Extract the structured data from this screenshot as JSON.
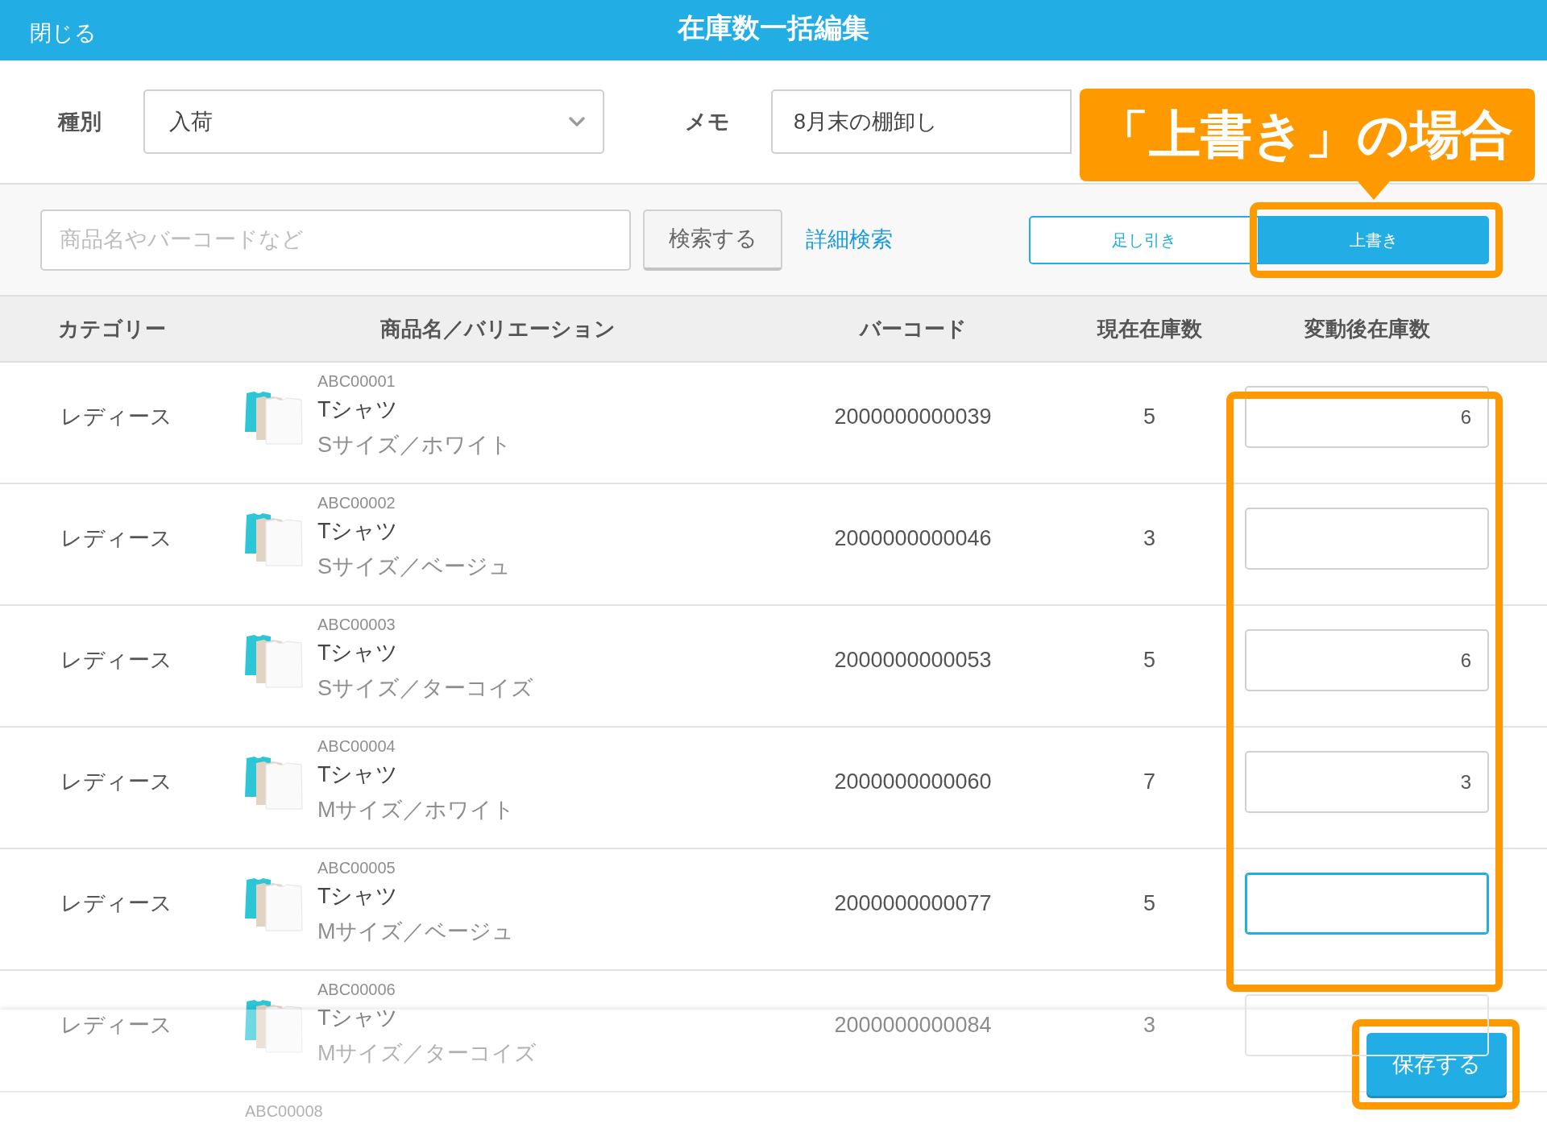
{
  "header": {
    "close": "閉じる",
    "title": "在庫数一括編集"
  },
  "form": {
    "type_label": "種別",
    "type_value": "入荷",
    "memo_label": "メモ",
    "memo_value": "8月末の棚卸し"
  },
  "search": {
    "placeholder": "商品名やバーコードなど",
    "button": "検索する",
    "advanced_link": "詳細検索"
  },
  "mode_tabs": [
    {
      "label": "足し引き",
      "selected": false,
      "highlighted": false
    },
    {
      "label": "上書き",
      "selected": true,
      "highlighted": true
    }
  ],
  "callout": {
    "text": "「上書き」の場合"
  },
  "table": {
    "columns": [
      {
        "label": "カテゴリー",
        "highlighted": false
      },
      {
        "label": "商品名／バリエーション",
        "highlighted": false
      },
      {
        "label": "バーコード",
        "highlighted": false
      },
      {
        "label": "現在在庫数",
        "highlighted": false
      },
      {
        "label": "変動後在庫数",
        "highlighted": true
      }
    ],
    "rows": [
      {
        "kind": "full",
        "category": "レディース",
        "code": "ABC00001",
        "name": "Tシャツ",
        "variation": "Sサイズ／ホワイト",
        "barcode": "2000000000039",
        "stock": "5",
        "new_stock": "6",
        "focused": false
      },
      {
        "kind": "full",
        "category": "レディース",
        "code": "ABC00002",
        "name": "Tシャツ",
        "variation": "Sサイズ／ベージュ",
        "barcode": "2000000000046",
        "stock": "3",
        "focused": false
      },
      {
        "kind": "full",
        "category": "レディース",
        "code": "ABC00003",
        "name": "Tシャツ",
        "variation": "Sサイズ／ターコイズ",
        "barcode": "2000000000053",
        "stock": "5",
        "new_stock": "6",
        "focused": false
      },
      {
        "kind": "full",
        "category": "レディース",
        "code": "ABC00004",
        "name": "Tシャツ",
        "variation": "Mサイズ／ホワイト",
        "barcode": "2000000000060",
        "stock": "7",
        "new_stock": "3",
        "focused": false
      },
      {
        "kind": "full",
        "category": "レディース",
        "code": "ABC00005",
        "name": "Tシャツ",
        "variation": "Mサイズ／ベージュ",
        "barcode": "2000000000077",
        "stock": "5",
        "focused": true
      },
      {
        "kind": "full",
        "category": "レディース",
        "code": "ABC00006",
        "name": "Tシャツ",
        "variation": "Mサイズ／ターコイズ",
        "barcode": "2000000000084",
        "stock": "3",
        "focused": false
      },
      {
        "kind": "partial",
        "code": "ABC00008"
      }
    ]
  },
  "footer": {
    "save_button": "保存する",
    "highlighted": true
  }
}
